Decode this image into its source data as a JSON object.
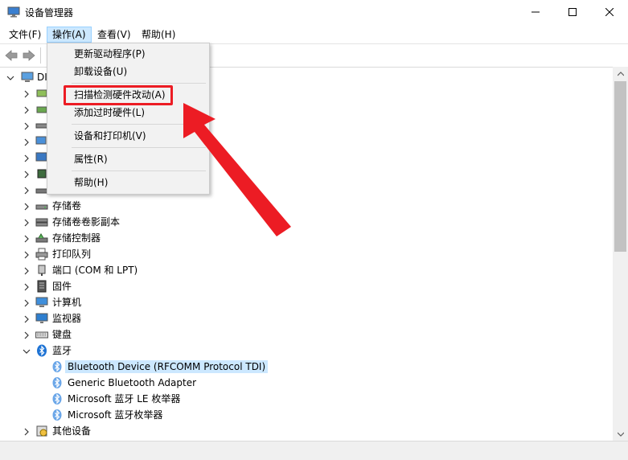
{
  "window": {
    "title": "设备管理器",
    "minimize_glyph": "—",
    "maximize_glyph": "☐",
    "close_glyph": "✕"
  },
  "menubar": {
    "items": [
      {
        "label": "文件(F)"
      },
      {
        "label": "操作(A)"
      },
      {
        "label": "查看(V)"
      },
      {
        "label": "帮助(H)"
      }
    ]
  },
  "action_menu": {
    "items": [
      {
        "label": "更新驱动程序(P)"
      },
      {
        "label": "卸载设备(U)"
      },
      {
        "label": "扫描检测硬件改动(A)"
      },
      {
        "label": "添加过时硬件(L)"
      },
      {
        "label": "设备和打印机(V)"
      },
      {
        "label": "属性(R)"
      },
      {
        "label": "帮助(H)"
      }
    ]
  },
  "tree": {
    "root_label": "DI",
    "nodes": [
      {
        "label": "存储卷",
        "icon": "storage-volume-icon"
      },
      {
        "label": "存储卷卷影副本",
        "icon": "shadow-copy-icon"
      },
      {
        "label": "存储控制器",
        "icon": "storage-controller-icon"
      },
      {
        "label": "打印队列",
        "icon": "print-queue-icon"
      },
      {
        "label": "端口 (COM 和 LPT)",
        "icon": "port-icon"
      },
      {
        "label": "固件",
        "icon": "firmware-icon"
      },
      {
        "label": "计算机",
        "icon": "computer-icon"
      },
      {
        "label": "监视器",
        "icon": "monitor-icon"
      },
      {
        "label": "键盘",
        "icon": "keyboard-icon"
      },
      {
        "label": "蓝牙",
        "icon": "bluetooth-icon"
      }
    ],
    "bluetooth_children": [
      {
        "label": "Bluetooth Device (RFCOMM Protocol TDI)"
      },
      {
        "label": "Generic Bluetooth Adapter"
      },
      {
        "label": "Microsoft 蓝牙 LE 枚举器"
      },
      {
        "label": "Microsoft 蓝牙枚举器"
      }
    ],
    "last_node": {
      "label": "其他设备",
      "icon": "other-devices-icon"
    }
  },
  "colors": {
    "highlight": "#ec1c24",
    "selection": "#cce8ff",
    "bluetooth": "#1e73d4"
  }
}
